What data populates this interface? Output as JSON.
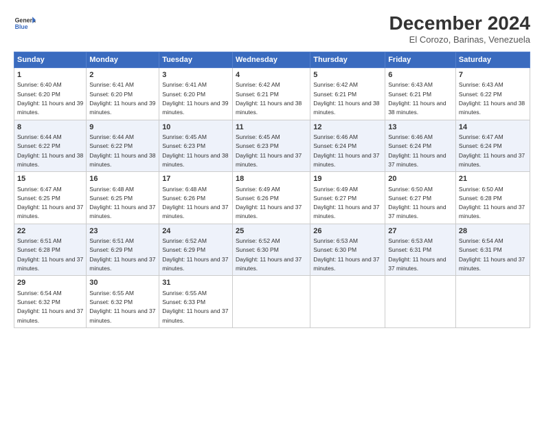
{
  "header": {
    "logo_line1": "General",
    "logo_line2": "Blue",
    "title": "December 2024",
    "subtitle": "El Corozo, Barinas, Venezuela"
  },
  "calendar": {
    "days_of_week": [
      "Sunday",
      "Monday",
      "Tuesday",
      "Wednesday",
      "Thursday",
      "Friday",
      "Saturday"
    ],
    "weeks": [
      [
        {
          "day": "1",
          "rise": "6:40 AM",
          "set": "6:20 PM",
          "daylight": "11 hours and 39 minutes."
        },
        {
          "day": "2",
          "rise": "6:41 AM",
          "set": "6:20 PM",
          "daylight": "11 hours and 39 minutes."
        },
        {
          "day": "3",
          "rise": "6:41 AM",
          "set": "6:20 PM",
          "daylight": "11 hours and 39 minutes."
        },
        {
          "day": "4",
          "rise": "6:42 AM",
          "set": "6:21 PM",
          "daylight": "11 hours and 38 minutes."
        },
        {
          "day": "5",
          "rise": "6:42 AM",
          "set": "6:21 PM",
          "daylight": "11 hours and 38 minutes."
        },
        {
          "day": "6",
          "rise": "6:43 AM",
          "set": "6:21 PM",
          "daylight": "11 hours and 38 minutes."
        },
        {
          "day": "7",
          "rise": "6:43 AM",
          "set": "6:22 PM",
          "daylight": "11 hours and 38 minutes."
        }
      ],
      [
        {
          "day": "8",
          "rise": "6:44 AM",
          "set": "6:22 PM",
          "daylight": "11 hours and 38 minutes."
        },
        {
          "day": "9",
          "rise": "6:44 AM",
          "set": "6:22 PM",
          "daylight": "11 hours and 38 minutes."
        },
        {
          "day": "10",
          "rise": "6:45 AM",
          "set": "6:23 PM",
          "daylight": "11 hours and 38 minutes."
        },
        {
          "day": "11",
          "rise": "6:45 AM",
          "set": "6:23 PM",
          "daylight": "11 hours and 37 minutes."
        },
        {
          "day": "12",
          "rise": "6:46 AM",
          "set": "6:24 PM",
          "daylight": "11 hours and 37 minutes."
        },
        {
          "day": "13",
          "rise": "6:46 AM",
          "set": "6:24 PM",
          "daylight": "11 hours and 37 minutes."
        },
        {
          "day": "14",
          "rise": "6:47 AM",
          "set": "6:24 PM",
          "daylight": "11 hours and 37 minutes."
        }
      ],
      [
        {
          "day": "15",
          "rise": "6:47 AM",
          "set": "6:25 PM",
          "daylight": "11 hours and 37 minutes."
        },
        {
          "day": "16",
          "rise": "6:48 AM",
          "set": "6:25 PM",
          "daylight": "11 hours and 37 minutes."
        },
        {
          "day": "17",
          "rise": "6:48 AM",
          "set": "6:26 PM",
          "daylight": "11 hours and 37 minutes."
        },
        {
          "day": "18",
          "rise": "6:49 AM",
          "set": "6:26 PM",
          "daylight": "11 hours and 37 minutes."
        },
        {
          "day": "19",
          "rise": "6:49 AM",
          "set": "6:27 PM",
          "daylight": "11 hours and 37 minutes."
        },
        {
          "day": "20",
          "rise": "6:50 AM",
          "set": "6:27 PM",
          "daylight": "11 hours and 37 minutes."
        },
        {
          "day": "21",
          "rise": "6:50 AM",
          "set": "6:28 PM",
          "daylight": "11 hours and 37 minutes."
        }
      ],
      [
        {
          "day": "22",
          "rise": "6:51 AM",
          "set": "6:28 PM",
          "daylight": "11 hours and 37 minutes."
        },
        {
          "day": "23",
          "rise": "6:51 AM",
          "set": "6:29 PM",
          "daylight": "11 hours and 37 minutes."
        },
        {
          "day": "24",
          "rise": "6:52 AM",
          "set": "6:29 PM",
          "daylight": "11 hours and 37 minutes."
        },
        {
          "day": "25",
          "rise": "6:52 AM",
          "set": "6:30 PM",
          "daylight": "11 hours and 37 minutes."
        },
        {
          "day": "26",
          "rise": "6:53 AM",
          "set": "6:30 PM",
          "daylight": "11 hours and 37 minutes."
        },
        {
          "day": "27",
          "rise": "6:53 AM",
          "set": "6:31 PM",
          "daylight": "11 hours and 37 minutes."
        },
        {
          "day": "28",
          "rise": "6:54 AM",
          "set": "6:31 PM",
          "daylight": "11 hours and 37 minutes."
        }
      ],
      [
        {
          "day": "29",
          "rise": "6:54 AM",
          "set": "6:32 PM",
          "daylight": "11 hours and 37 minutes."
        },
        {
          "day": "30",
          "rise": "6:55 AM",
          "set": "6:32 PM",
          "daylight": "11 hours and 37 minutes."
        },
        {
          "day": "31",
          "rise": "6:55 AM",
          "set": "6:33 PM",
          "daylight": "11 hours and 37 minutes."
        },
        null,
        null,
        null,
        null
      ]
    ]
  }
}
